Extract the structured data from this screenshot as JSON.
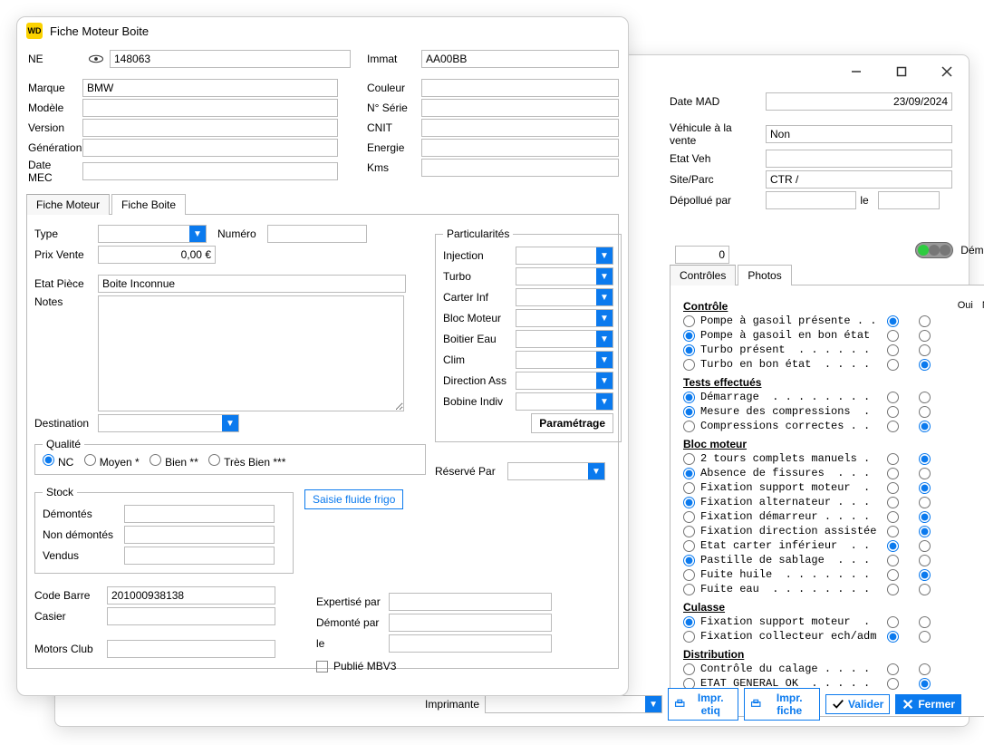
{
  "w1": {
    "title": "Fiche Moteur Boite",
    "labels": {
      "ne": "NE",
      "marque": "Marque",
      "modele": "Modèle",
      "version": "Version",
      "generation": "Génération",
      "date_mec": "Date MEC",
      "immat": "Immat",
      "couleur": "Couleur",
      "nserie": "N° Série",
      "cnit": "CNIT",
      "energie": "Energie",
      "kms": "Kms",
      "tab_moteur": "Fiche Moteur",
      "tab_boite": "Fiche Boite",
      "type": "Type",
      "numero": "Numéro",
      "prix": "Prix Vente",
      "etat_piece": "Etat Pièce",
      "notes": "Notes",
      "particularites": "Particularités",
      "injection": "Injection",
      "turbo": "Turbo",
      "carter": "Carter Inf",
      "bloc": "Bloc Moteur",
      "boitier": "Boitier Eau",
      "clim": "Clim",
      "direction": "Direction Ass",
      "bobine": "Bobine Indiv",
      "parametrage": "Paramétrage",
      "destination": "Destination",
      "qualite": "Qualité",
      "qual_nc": "NC",
      "qual_moyen": "Moyen *",
      "qual_bien": "Bien **",
      "qual_tresbien": "Très Bien ***",
      "reserve": "Réservé Par",
      "stock": "Stock",
      "demontes": "Démontés",
      "non_demontes": "Non démontés",
      "vendus": "Vendus",
      "saisie": "Saisie fluide frigo",
      "code_barre": "Code Barre",
      "casier": "Casier",
      "expertise": "Expertisé par",
      "demonte_par": "Démonté par",
      "le": "le",
      "motors_club": "Motors Club",
      "publie": "Publié MBV3"
    },
    "values": {
      "ne": "148063",
      "marque": "BMW",
      "modele": "",
      "version": "",
      "generation": "",
      "date_mec": "",
      "immat": "AA00BB",
      "couleur": "",
      "nserie": "",
      "cnit": "",
      "energie": "",
      "kms": "",
      "type": "",
      "numero": "",
      "prix": "0,00 €",
      "etat_piece": "Boite Inconnue",
      "code_barre": "201000938138",
      "casier": "",
      "expertise": "",
      "demonte_par": "",
      "le": "",
      "motors_club": ""
    }
  },
  "w2": {
    "labels": {
      "date_mad": "Date MAD",
      "veh_vente": "Véhicule à la vente",
      "etat_veh": "Etat Veh",
      "site_parc": "Site/Parc",
      "depollue": "Dépollué par",
      "le": "le",
      "status": "Démonté",
      "tab_controles": "Contrôles",
      "tab_photos": "Photos",
      "oui": "Oui",
      "non": "Non",
      "imprimante": "Imprimante",
      "impr_etiq": "Impr. etiq",
      "impr_fiche": "Impr. fiche",
      "valider": "Valider",
      "fermer": "Fermer"
    },
    "values": {
      "date_mad": "23/09/2024",
      "veh_vente": "Non",
      "etat_veh": "",
      "site_parc": "CTR /",
      "depollue": "",
      "le": "",
      "hidden_num": "0",
      "imprimante": ""
    },
    "sections": [
      {
        "title": "Contrôle",
        "items": [
          {
            "label": "Pompe à gasoil présente . .",
            "pre": false,
            "oui": true,
            "non": false
          },
          {
            "label": "Pompe à gasoil en bon état ",
            "pre": true,
            "oui": false,
            "non": false
          },
          {
            "label": "Turbo présent  . . . . . . ",
            "pre": true,
            "oui": false,
            "non": false
          },
          {
            "label": "Turbo en bon état  . . . . ",
            "pre": false,
            "oui": false,
            "non": true
          }
        ]
      },
      {
        "title": "Tests effectués",
        "items": [
          {
            "label": "Démarrage  . . . . . . . . ",
            "pre": true,
            "oui": false,
            "non": false
          },
          {
            "label": "Mesure des compressions  . ",
            "pre": true,
            "oui": false,
            "non": false
          },
          {
            "label": "Compressions correctes . . ",
            "pre": false,
            "oui": false,
            "non": true
          }
        ]
      },
      {
        "title": "Bloc moteur",
        "items": [
          {
            "label": "2 tours complets manuels . ",
            "pre": false,
            "oui": false,
            "non": true
          },
          {
            "label": "Absence de fissures  . . . ",
            "pre": true,
            "oui": false,
            "non": false
          },
          {
            "label": "Fixation support moteur  . ",
            "pre": false,
            "oui": false,
            "non": true
          },
          {
            "label": "Fixation alternateur . . . ",
            "pre": true,
            "oui": false,
            "non": false
          },
          {
            "label": "Fixation démarreur . . . . ",
            "pre": false,
            "oui": false,
            "non": true
          },
          {
            "label": "Fixation direction assistée",
            "pre": false,
            "oui": false,
            "non": true
          },
          {
            "label": "Etat carter inférieur  . . ",
            "pre": false,
            "oui": true,
            "non": false
          },
          {
            "label": "Pastille de sablage  . . . ",
            "pre": true,
            "oui": false,
            "non": false
          },
          {
            "label": "Fuite huile  . . . . . . . ",
            "pre": false,
            "oui": false,
            "non": true
          },
          {
            "label": "Fuite eau  . . . . . . . . ",
            "pre": false,
            "oui": false,
            "non": false
          }
        ]
      },
      {
        "title": "Culasse",
        "items": [
          {
            "label": "Fixation support moteur  . ",
            "pre": true,
            "oui": false,
            "non": false
          },
          {
            "label": "Fixation collecteur ech/adm",
            "pre": false,
            "oui": true,
            "non": false
          }
        ]
      },
      {
        "title": "Distribution",
        "items": [
          {
            "label": "Contrôle du calage . . . . ",
            "pre": false,
            "oui": false,
            "non": false
          },
          {
            "label": "ETAT GENERAL OK  . . . . . ",
            "pre": false,
            "oui": false,
            "non": true
          }
        ]
      }
    ]
  }
}
